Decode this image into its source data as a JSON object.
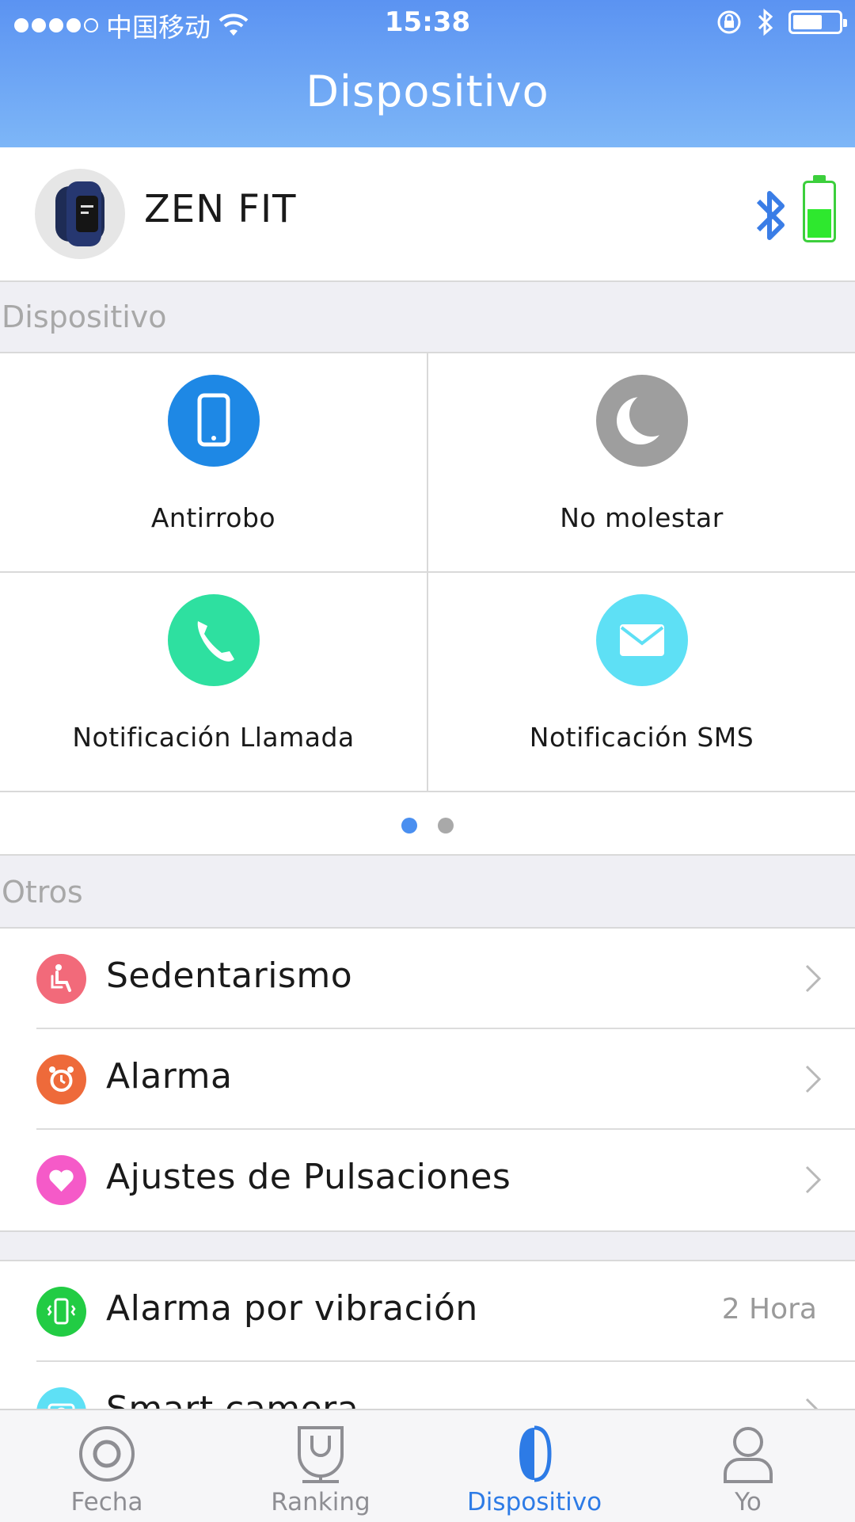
{
  "status_bar": {
    "carrier": "中国移动",
    "time": "15:38"
  },
  "header": {
    "title": "Dispositivo"
  },
  "device": {
    "name": "ZEN FIT",
    "battery_level": 0.5
  },
  "sections": {
    "device_section": "Dispositivo",
    "others_section": "Otros"
  },
  "grid": [
    {
      "label": "Antirrobo",
      "icon": "phone-device-icon",
      "color": "#1e88e5"
    },
    {
      "label": "No molestar",
      "icon": "moon-icon",
      "color": "#9e9e9e"
    },
    {
      "label": "Notificación Llamada",
      "icon": "call-icon",
      "color": "#2ee0a0"
    },
    {
      "label": "Notificación SMS",
      "icon": "mail-icon",
      "color": "#5ee0f5"
    }
  ],
  "pager": {
    "pages": 2,
    "current": 1,
    "active_color": "#4a8ff0",
    "inactive_color": "#a9a9a9"
  },
  "others_list": [
    {
      "label": "Sedentarismo",
      "icon": "sitting-person-icon",
      "color": "#f26a7a"
    },
    {
      "label": "Alarma",
      "icon": "alarm-clock-icon",
      "color": "#ee6a3a"
    },
    {
      "label": "Ajustes de Pulsaciones",
      "icon": "heart-icon",
      "color": "#f55ac8"
    }
  ],
  "extra_list": [
    {
      "label": "Alarma por vibración",
      "value": "2 Hora",
      "icon": "vibration-icon",
      "color": "#22cc44"
    },
    {
      "label": "Smart camera",
      "icon": "camera-icon",
      "color": "#5ee0f5"
    }
  ],
  "tabbar": {
    "tabs": [
      {
        "label": "Fecha",
        "icon": "target-circle-icon"
      },
      {
        "label": "Ranking",
        "icon": "trophy-icon"
      },
      {
        "label": "Dispositivo",
        "icon": "band-icon",
        "active": true
      },
      {
        "label": "Yo",
        "icon": "person-icon"
      }
    ],
    "active_color": "#2d7be6"
  }
}
